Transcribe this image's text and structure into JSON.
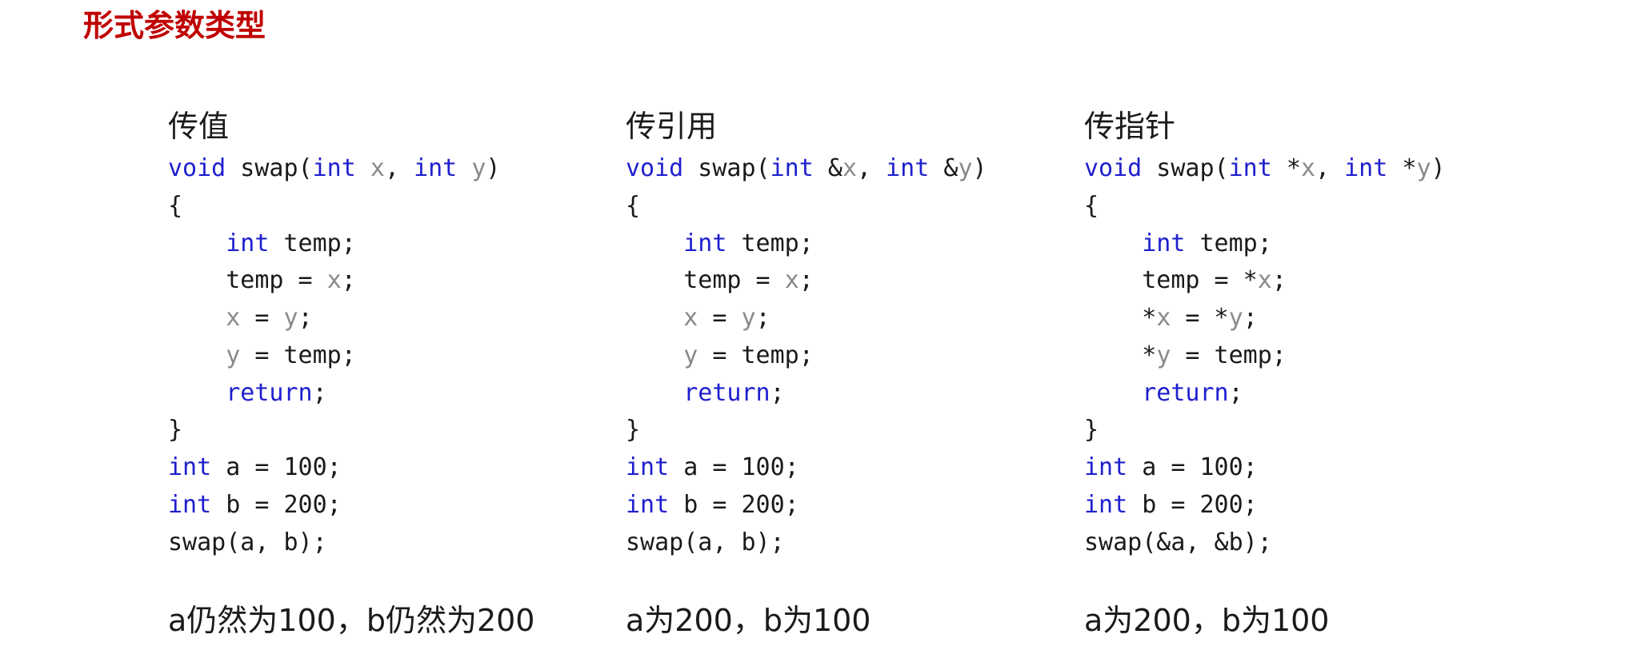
{
  "slide": {
    "title": "形式参数类型"
  },
  "colors": {
    "title": "#c00000",
    "keyword": "#1f1fcf",
    "variable": "#8a8a8a",
    "text": "#1a1a1a"
  },
  "columns": [
    {
      "heading": "传值",
      "code_lines": [
        [
          {
            "t": "void",
            "c": "kw"
          },
          {
            "t": " swap(",
            "c": "pun"
          },
          {
            "t": "int",
            "c": "kw"
          },
          {
            "t": " ",
            "c": "pun"
          },
          {
            "t": "x",
            "c": "var"
          },
          {
            "t": ", ",
            "c": "pun"
          },
          {
            "t": "int",
            "c": "kw"
          },
          {
            "t": " ",
            "c": "pun"
          },
          {
            "t": "y",
            "c": "var"
          },
          {
            "t": ")",
            "c": "pun"
          }
        ],
        [
          {
            "t": "{",
            "c": "pun"
          }
        ],
        [
          {
            "t": "    ",
            "c": "pun"
          },
          {
            "t": "int",
            "c": "kw"
          },
          {
            "t": " temp;",
            "c": "pun"
          }
        ],
        [
          {
            "t": "    temp = ",
            "c": "pun"
          },
          {
            "t": "x",
            "c": "var"
          },
          {
            "t": ";",
            "c": "pun"
          }
        ],
        [
          {
            "t": "    ",
            "c": "pun"
          },
          {
            "t": "x",
            "c": "var"
          },
          {
            "t": " = ",
            "c": "pun"
          },
          {
            "t": "y",
            "c": "var"
          },
          {
            "t": ";",
            "c": "pun"
          }
        ],
        [
          {
            "t": "    ",
            "c": "pun"
          },
          {
            "t": "y",
            "c": "var"
          },
          {
            "t": " = temp;",
            "c": "pun"
          }
        ],
        [
          {
            "t": "    ",
            "c": "pun"
          },
          {
            "t": "return",
            "c": "kw"
          },
          {
            "t": ";",
            "c": "pun"
          }
        ],
        [
          {
            "t": "}",
            "c": "pun"
          }
        ],
        [
          {
            "t": "int",
            "c": "kw"
          },
          {
            "t": " a = 100;",
            "c": "pun"
          }
        ],
        [
          {
            "t": "int",
            "c": "kw"
          },
          {
            "t": " b = 200;",
            "c": "pun"
          }
        ],
        [
          {
            "t": "swap(a, b);",
            "c": "pun"
          }
        ]
      ],
      "result": "a仍然为100，b仍然为200"
    },
    {
      "heading": "传引用",
      "code_lines": [
        [
          {
            "t": "void",
            "c": "kw"
          },
          {
            "t": " swap(",
            "c": "pun"
          },
          {
            "t": "int",
            "c": "kw"
          },
          {
            "t": " &",
            "c": "pun"
          },
          {
            "t": "x",
            "c": "var"
          },
          {
            "t": ", ",
            "c": "pun"
          },
          {
            "t": "int",
            "c": "kw"
          },
          {
            "t": " &",
            "c": "pun"
          },
          {
            "t": "y",
            "c": "var"
          },
          {
            "t": ")",
            "c": "pun"
          }
        ],
        [
          {
            "t": "{",
            "c": "pun"
          }
        ],
        [
          {
            "t": "    ",
            "c": "pun"
          },
          {
            "t": "int",
            "c": "kw"
          },
          {
            "t": " temp;",
            "c": "pun"
          }
        ],
        [
          {
            "t": "    temp = ",
            "c": "pun"
          },
          {
            "t": "x",
            "c": "var"
          },
          {
            "t": ";",
            "c": "pun"
          }
        ],
        [
          {
            "t": "    ",
            "c": "pun"
          },
          {
            "t": "x",
            "c": "var"
          },
          {
            "t": " = ",
            "c": "pun"
          },
          {
            "t": "y",
            "c": "var"
          },
          {
            "t": ";",
            "c": "pun"
          }
        ],
        [
          {
            "t": "    ",
            "c": "pun"
          },
          {
            "t": "y",
            "c": "var"
          },
          {
            "t": " = temp;",
            "c": "pun"
          }
        ],
        [
          {
            "t": "    ",
            "c": "pun"
          },
          {
            "t": "return",
            "c": "kw"
          },
          {
            "t": ";",
            "c": "pun"
          }
        ],
        [
          {
            "t": "}",
            "c": "pun"
          }
        ],
        [
          {
            "t": "int",
            "c": "kw"
          },
          {
            "t": " a = 100;",
            "c": "pun"
          }
        ],
        [
          {
            "t": "int",
            "c": "kw"
          },
          {
            "t": " b = 200;",
            "c": "pun"
          }
        ],
        [
          {
            "t": "swap(a, b);",
            "c": "pun"
          }
        ]
      ],
      "result": "a为200，b为100"
    },
    {
      "heading": "传指针",
      "code_lines": [
        [
          {
            "t": "void",
            "c": "kw"
          },
          {
            "t": " swap(",
            "c": "pun"
          },
          {
            "t": "int",
            "c": "kw"
          },
          {
            "t": " *",
            "c": "pun"
          },
          {
            "t": "x",
            "c": "var"
          },
          {
            "t": ", ",
            "c": "pun"
          },
          {
            "t": "int",
            "c": "kw"
          },
          {
            "t": " *",
            "c": "pun"
          },
          {
            "t": "y",
            "c": "var"
          },
          {
            "t": ")",
            "c": "pun"
          }
        ],
        [
          {
            "t": "{",
            "c": "pun"
          }
        ],
        [
          {
            "t": "    ",
            "c": "pun"
          },
          {
            "t": "int",
            "c": "kw"
          },
          {
            "t": " temp;",
            "c": "pun"
          }
        ],
        [
          {
            "t": "    temp = *",
            "c": "pun"
          },
          {
            "t": "x",
            "c": "var"
          },
          {
            "t": ";",
            "c": "pun"
          }
        ],
        [
          {
            "t": "    *",
            "c": "pun"
          },
          {
            "t": "x",
            "c": "var"
          },
          {
            "t": " = *",
            "c": "pun"
          },
          {
            "t": "y",
            "c": "var"
          },
          {
            "t": ";",
            "c": "pun"
          }
        ],
        [
          {
            "t": "    *",
            "c": "pun"
          },
          {
            "t": "y",
            "c": "var"
          },
          {
            "t": " = temp;",
            "c": "pun"
          }
        ],
        [
          {
            "t": "    ",
            "c": "pun"
          },
          {
            "t": "return",
            "c": "kw"
          },
          {
            "t": ";",
            "c": "pun"
          }
        ],
        [
          {
            "t": "}",
            "c": "pun"
          }
        ],
        [
          {
            "t": "int",
            "c": "kw"
          },
          {
            "t": " a = 100;",
            "c": "pun"
          }
        ],
        [
          {
            "t": "int",
            "c": "kw"
          },
          {
            "t": " b = 200;",
            "c": "pun"
          }
        ],
        [
          {
            "t": "swap(&a, &b);",
            "c": "pun"
          }
        ]
      ],
      "result": "a为200，b为100"
    }
  ]
}
